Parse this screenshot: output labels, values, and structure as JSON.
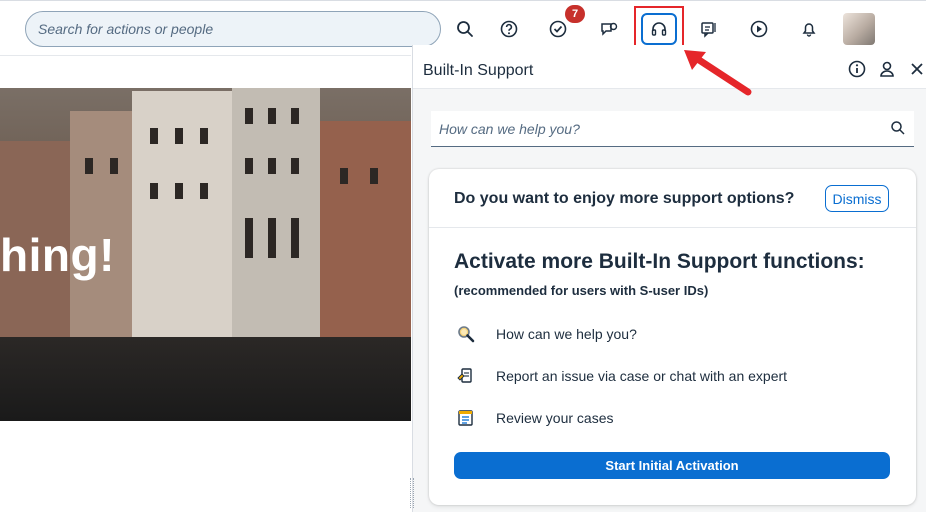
{
  "shellbar": {
    "search_placeholder": "Search for actions or people",
    "notification_count": "7",
    "icons": [
      "search-icon",
      "help-icon",
      "tasks-icon",
      "chat-icon",
      "headset-icon",
      "feedback-icon",
      "play-icon",
      "bell-icon",
      "avatar"
    ]
  },
  "hero": {
    "text": "hing!"
  },
  "panel": {
    "title": "Built-In Support",
    "search_placeholder": "How can we help you?",
    "card": {
      "question": "Do you want to enjoy more support options?",
      "dismiss_label": "Dismiss",
      "title": "Activate more Built-In Support functions:",
      "subtitle": "(recommended for users with S-user IDs)",
      "features": [
        {
          "icon": "magnifier-icon",
          "label": "How can we help you?"
        },
        {
          "icon": "report-issue-icon",
          "label": "Report an issue via case or chat with an expert"
        },
        {
          "icon": "cases-list-icon",
          "label": "Review your cases"
        }
      ],
      "cta_label": "Start Initial Activation"
    }
  },
  "colors": {
    "accent": "#0a6ed1",
    "highlight_box": "#e5262a",
    "badge": "#c7302b"
  }
}
